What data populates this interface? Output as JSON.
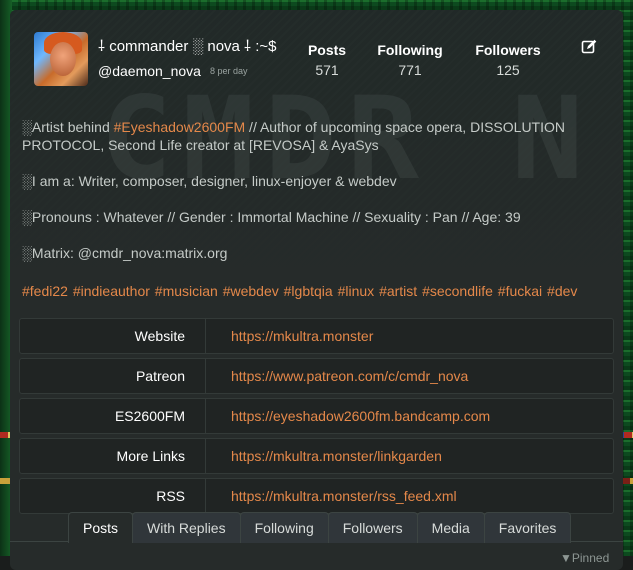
{
  "profile": {
    "display_name": "⸸ commander ░ nova ⸸ :~$",
    "handle": "@daemon_nova",
    "per_day": "8 per day",
    "banner_text": "CMDR N"
  },
  "stats": [
    {
      "label": "Posts",
      "count": "571"
    },
    {
      "label": "Following",
      "count": "771"
    },
    {
      "label": "Followers",
      "count": "125"
    }
  ],
  "bio": {
    "line1_prefix": "░Artist behind ",
    "line1_link": "#Eyeshadow2600FM",
    "line1_suffix": " // Author of upcoming space opera, DISSOLUTION PROTOCOL, Second Life creator at [REVOSA] & AyaSys",
    "line2": "░I am a: Writer, composer, designer, linux-enjoyer & webdev",
    "line3": "░Pronouns : Whatever // Gender : Immortal Machine // Sexuality : Pan // Age: 39",
    "line4": "░Matrix: @cmdr_nova:matrix.org"
  },
  "tags": [
    "#fedi22",
    "#indieauthor",
    "#musician",
    "#webdev",
    "#lgbtqia",
    "#linux",
    "#artist",
    "#secondlife",
    "#fuckai",
    "#dev"
  ],
  "fields": [
    {
      "name": "Website",
      "value": "https://mkultra.monster"
    },
    {
      "name": "Patreon",
      "value": "https://www.patreon.com/c/cmdr_nova"
    },
    {
      "name": "ES2600FM",
      "value": "https://eyeshadow2600fm.bandcamp.com"
    },
    {
      "name": "More Links",
      "value": "https://mkultra.monster/linkgarden"
    },
    {
      "name": "RSS",
      "value": "https://mkultra.monster/rss_feed.xml"
    }
  ],
  "tabs": [
    "Posts",
    "With Replies",
    "Following",
    "Followers",
    "Media",
    "Favorites"
  ],
  "pinned_label": "Pinned",
  "colors": {
    "accent": "#e4884a",
    "card": "#262b2a",
    "background_green": "#1b6d2c"
  }
}
